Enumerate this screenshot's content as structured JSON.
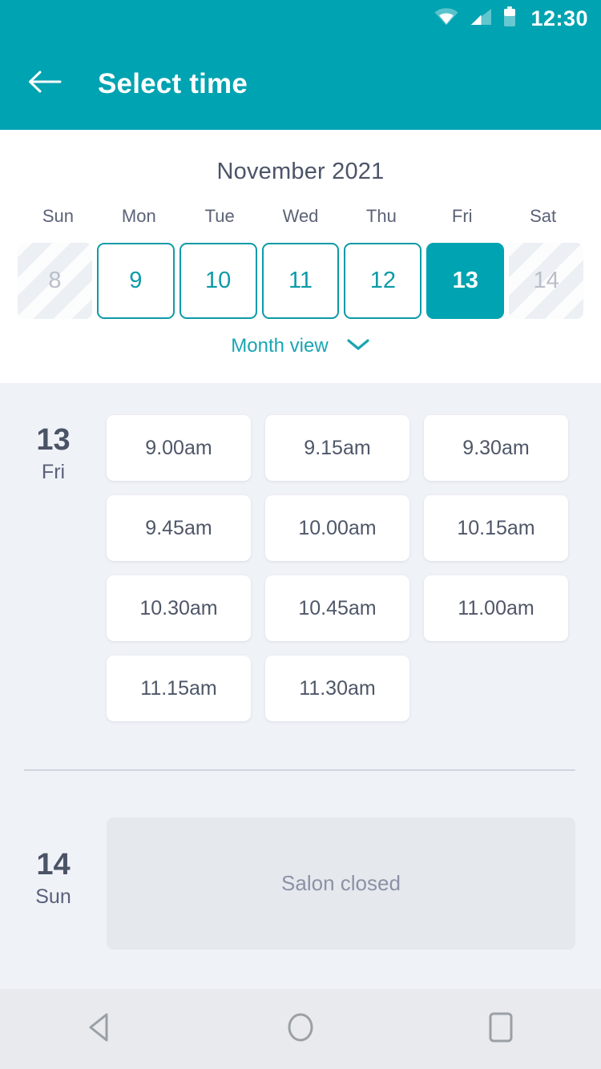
{
  "theme": {
    "accent": "#00a3b1",
    "accent_link": "#1aa5b2",
    "text_dark": "#4c5468",
    "page_bg": "#eff2f7",
    "nav_bg": "#e8eaed",
    "closed_panel_bg": "#e5e8ed"
  },
  "status_bar": {
    "clock": "12:30",
    "icons": [
      "wifi-icon",
      "cellular-signal-icon",
      "battery-icon"
    ]
  },
  "app_bar": {
    "back_icon": "arrow-left-icon",
    "title": "Select time"
  },
  "calendar": {
    "month_title": "November 2021",
    "day_of_week_headers": [
      "Sun",
      "Mon",
      "Tue",
      "Wed",
      "Thu",
      "Fri",
      "Sat"
    ],
    "days": [
      {
        "number": "8",
        "state": "disabled"
      },
      {
        "number": "9",
        "state": "available"
      },
      {
        "number": "10",
        "state": "available"
      },
      {
        "number": "11",
        "state": "available"
      },
      {
        "number": "12",
        "state": "available"
      },
      {
        "number": "13",
        "state": "selected"
      },
      {
        "number": "14",
        "state": "disabled"
      }
    ],
    "month_view_label": "Month view",
    "month_view_icon": "chevron-down-icon"
  },
  "schedule": [
    {
      "day_number": "13",
      "day_name": "Fri",
      "slots": [
        "9.00am",
        "9.15am",
        "9.30am",
        "9.45am",
        "10.00am",
        "10.15am",
        "10.30am",
        "10.45am",
        "11.00am",
        "11.15am",
        "11.30am"
      ]
    },
    {
      "day_number": "14",
      "day_name": "Sun",
      "closed_message": "Salon closed"
    }
  ],
  "nav_bar": {
    "back_label": "back-triangle-icon",
    "home_label": "home-circle-icon",
    "recents_label": "recents-square-icon"
  }
}
